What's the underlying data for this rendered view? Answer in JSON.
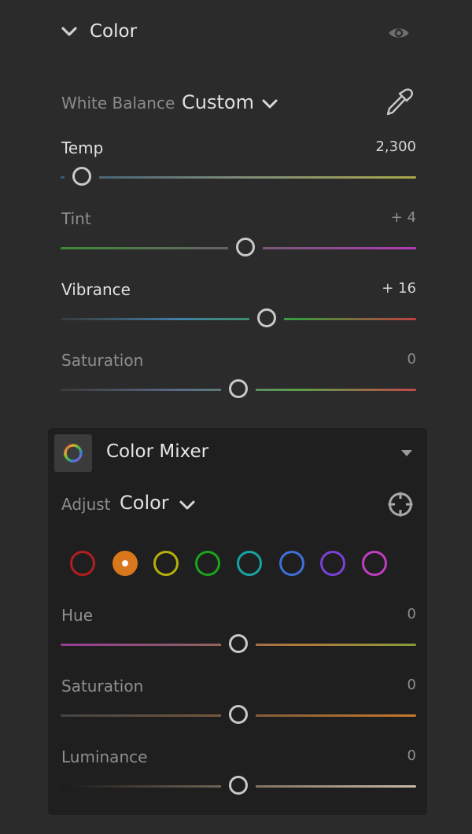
{
  "color_section": {
    "title": "Color",
    "collapse_icon": "chevron-down-icon",
    "visibility_icon": "eye-icon",
    "white_balance": {
      "label": "White Balance",
      "value": "Custom",
      "picker_icon": "eyedropper-icon"
    },
    "sliders": [
      {
        "id": "temp",
        "label": "Temp",
        "value": "2,300",
        "level": 0.06,
        "colors": [
          "#3c5a78",
          "#7d8b7a",
          "#a9a84a"
        ]
      },
      {
        "id": "tint",
        "label": "Tint",
        "value": "+ 4",
        "level": 0.52,
        "colors": [
          "#3d8a36",
          "#6a5e6a",
          "#b03ab6"
        ]
      },
      {
        "id": "vibrance",
        "label": "Vibrance",
        "value": "+ 16",
        "level": 0.58,
        "colors": [
          "#3a3a3a",
          "#3f7fa8",
          "#3b9a3b",
          "#c04040"
        ]
      },
      {
        "id": "saturation",
        "label": "Saturation",
        "value": "0",
        "level": 0.5,
        "colors": [
          "#3a3a3a",
          "#5a6a8a",
          "#5ca04b",
          "#c44848"
        ]
      }
    ]
  },
  "color_mixer": {
    "title": "Color Mixer",
    "icon": "color-wheel-icon",
    "collapse_icon": "caret-down-icon",
    "adjust": {
      "label": "Adjust",
      "value": "Color",
      "target_icon": "targeted-adjustment-icon"
    },
    "swatches": [
      {
        "name": "red",
        "color": "#b51e1e",
        "selected": false
      },
      {
        "name": "orange",
        "color": "#d9771c",
        "selected": true
      },
      {
        "name": "yellow",
        "color": "#b5b00e",
        "selected": false
      },
      {
        "name": "green",
        "color": "#1ba41b",
        "selected": false
      },
      {
        "name": "aqua",
        "color": "#17a3a3",
        "selected": false
      },
      {
        "name": "blue",
        "color": "#3f6fd8",
        "selected": false
      },
      {
        "name": "purple",
        "color": "#7a41d6",
        "selected": false
      },
      {
        "name": "magenta",
        "color": "#c23cbf",
        "selected": false
      }
    ],
    "sliders": [
      {
        "id": "hue",
        "label": "Hue",
        "value": "0",
        "level": 0.5,
        "colors": [
          "#9a3d9a",
          "#8a5a6a",
          "#b07a3a",
          "#8a9a3a"
        ]
      },
      {
        "id": "saturation",
        "label": "Saturation",
        "value": "0",
        "level": 0.5,
        "colors": [
          "#444444",
          "#7a5a3a",
          "#c9782a"
        ]
      },
      {
        "id": "luminance",
        "label": "Luminance",
        "value": "0",
        "level": 0.5,
        "colors": [
          "#1a1a1a",
          "#7a6a5a",
          "#c7b9a8"
        ]
      }
    ]
  }
}
